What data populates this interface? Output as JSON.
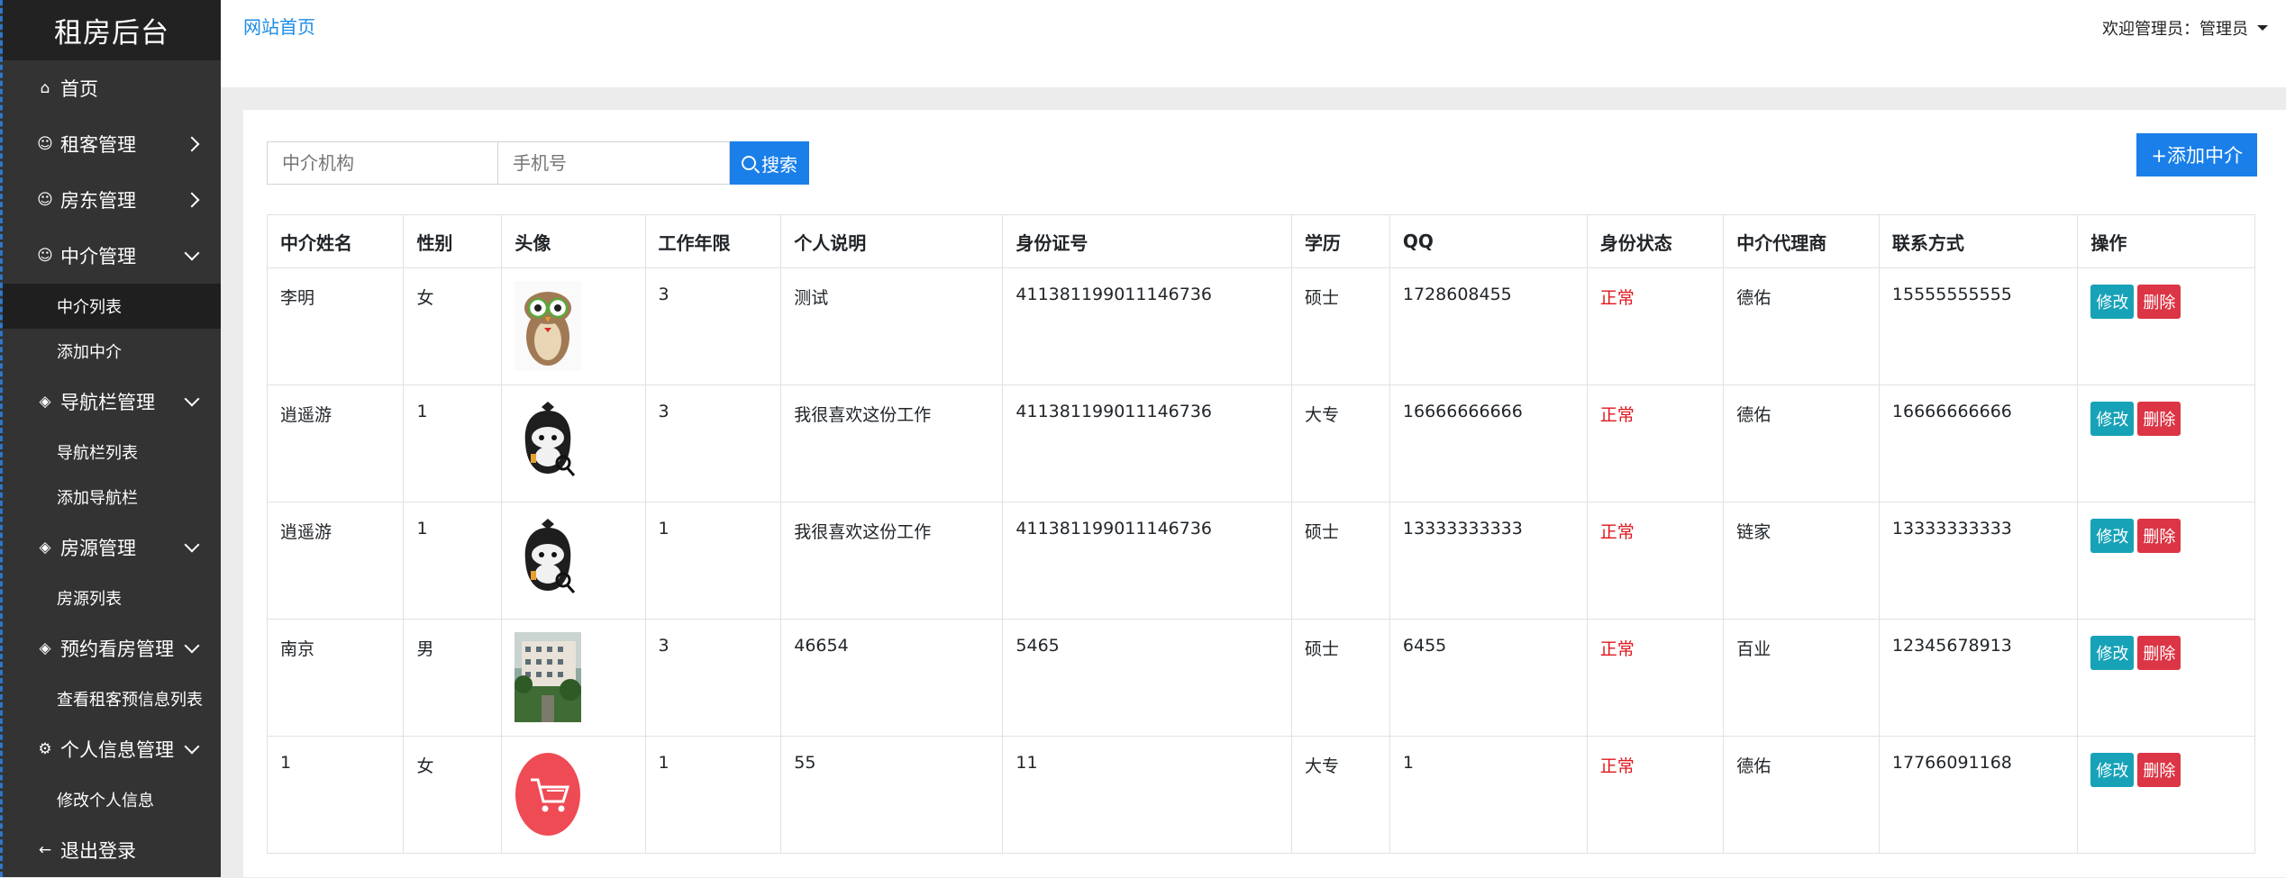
{
  "app_title": "租房后台",
  "sidebar": {
    "items": [
      {
        "label": "首页",
        "icon": "home-icon",
        "chevron": "none"
      },
      {
        "label": "租客管理",
        "icon": "user-circle-icon",
        "chevron": "right"
      },
      {
        "label": "房东管理",
        "icon": "user-circle-icon",
        "chevron": "right"
      },
      {
        "label": "中介管理",
        "icon": "user-circle-icon",
        "chevron": "down",
        "children": [
          "中介列表",
          "添加中介"
        ]
      },
      {
        "label": "导航栏管理",
        "icon": "layers-icon",
        "chevron": "down",
        "children": [
          "导航栏列表",
          "添加导航栏"
        ]
      },
      {
        "label": "房源管理",
        "icon": "layers-icon",
        "chevron": "down",
        "children": [
          "房源列表"
        ]
      },
      {
        "label": "预约看房管理",
        "icon": "layers-icon",
        "chevron": "down",
        "children": [
          "查看租客预信息列表"
        ]
      },
      {
        "label": "个人信息管理",
        "icon": "gear-icon",
        "chevron": "down",
        "children": [
          "修改个人信息"
        ]
      },
      {
        "label": "退出登录",
        "icon": "arrow-left-icon",
        "chevron": "none"
      }
    ],
    "active_sub": "中介列表"
  },
  "topbar": {
    "home_link": "网站首页",
    "user_menu": "欢迎管理员：管理员"
  },
  "search": {
    "agency_placeholder": "中介机构",
    "phone_placeholder": "手机号",
    "button_label": "搜索"
  },
  "add_button": "+添加中介",
  "table": {
    "headers": [
      "中介姓名",
      "性别",
      "头像",
      "工作年限",
      "个人说明",
      "身份证号",
      "学历",
      "QQ",
      "身份状态",
      "中介代理商",
      "联系方式",
      "操作"
    ],
    "rows": [
      {
        "name": "李明",
        "gender": "女",
        "avatar": "owl-avatar",
        "years": "3",
        "desc": "测试",
        "id_no": "411381199011146736",
        "edu": "硕士",
        "qq": "1728608455",
        "status": "正常",
        "agent": "德佑",
        "phone": "15555555555"
      },
      {
        "name": "逍遥游",
        "gender": "1",
        "avatar": "gorilla-avatar",
        "years": "3",
        "desc": "我很喜欢这份工作",
        "id_no": "411381199011146736",
        "edu": "大专",
        "qq": "16666666666",
        "status": "正常",
        "agent": "德佑",
        "phone": "16666666666"
      },
      {
        "name": "逍遥游",
        "gender": "1",
        "avatar": "gorilla-avatar",
        "years": "1",
        "desc": "我很喜欢这份工作",
        "id_no": "411381199011146736",
        "edu": "硕士",
        "qq": "13333333333",
        "status": "正常",
        "agent": "链家",
        "phone": "13333333333"
      },
      {
        "name": "南京",
        "gender": "男",
        "avatar": "building-photo",
        "years": "3",
        "desc": "46654",
        "id_no": "5465",
        "edu": "硕士",
        "qq": "6455",
        "status": "正常",
        "agent": "百业",
        "phone": "12345678913"
      },
      {
        "name": "1",
        "gender": "女",
        "avatar": "cart-avatar",
        "years": "1",
        "desc": "55",
        "id_no": "11",
        "edu": "大专",
        "qq": "1",
        "status": "正常",
        "agent": "德佑",
        "phone": "17766091168"
      }
    ],
    "edit_label": "修改",
    "delete_label": "删除"
  },
  "colors": {
    "sidebar_bg": "#333333",
    "brand_bg": "#222222",
    "primary": "#1a7fe8",
    "edit": "#17a2b8",
    "delete": "#dc3545",
    "status": "#e0161d"
  }
}
